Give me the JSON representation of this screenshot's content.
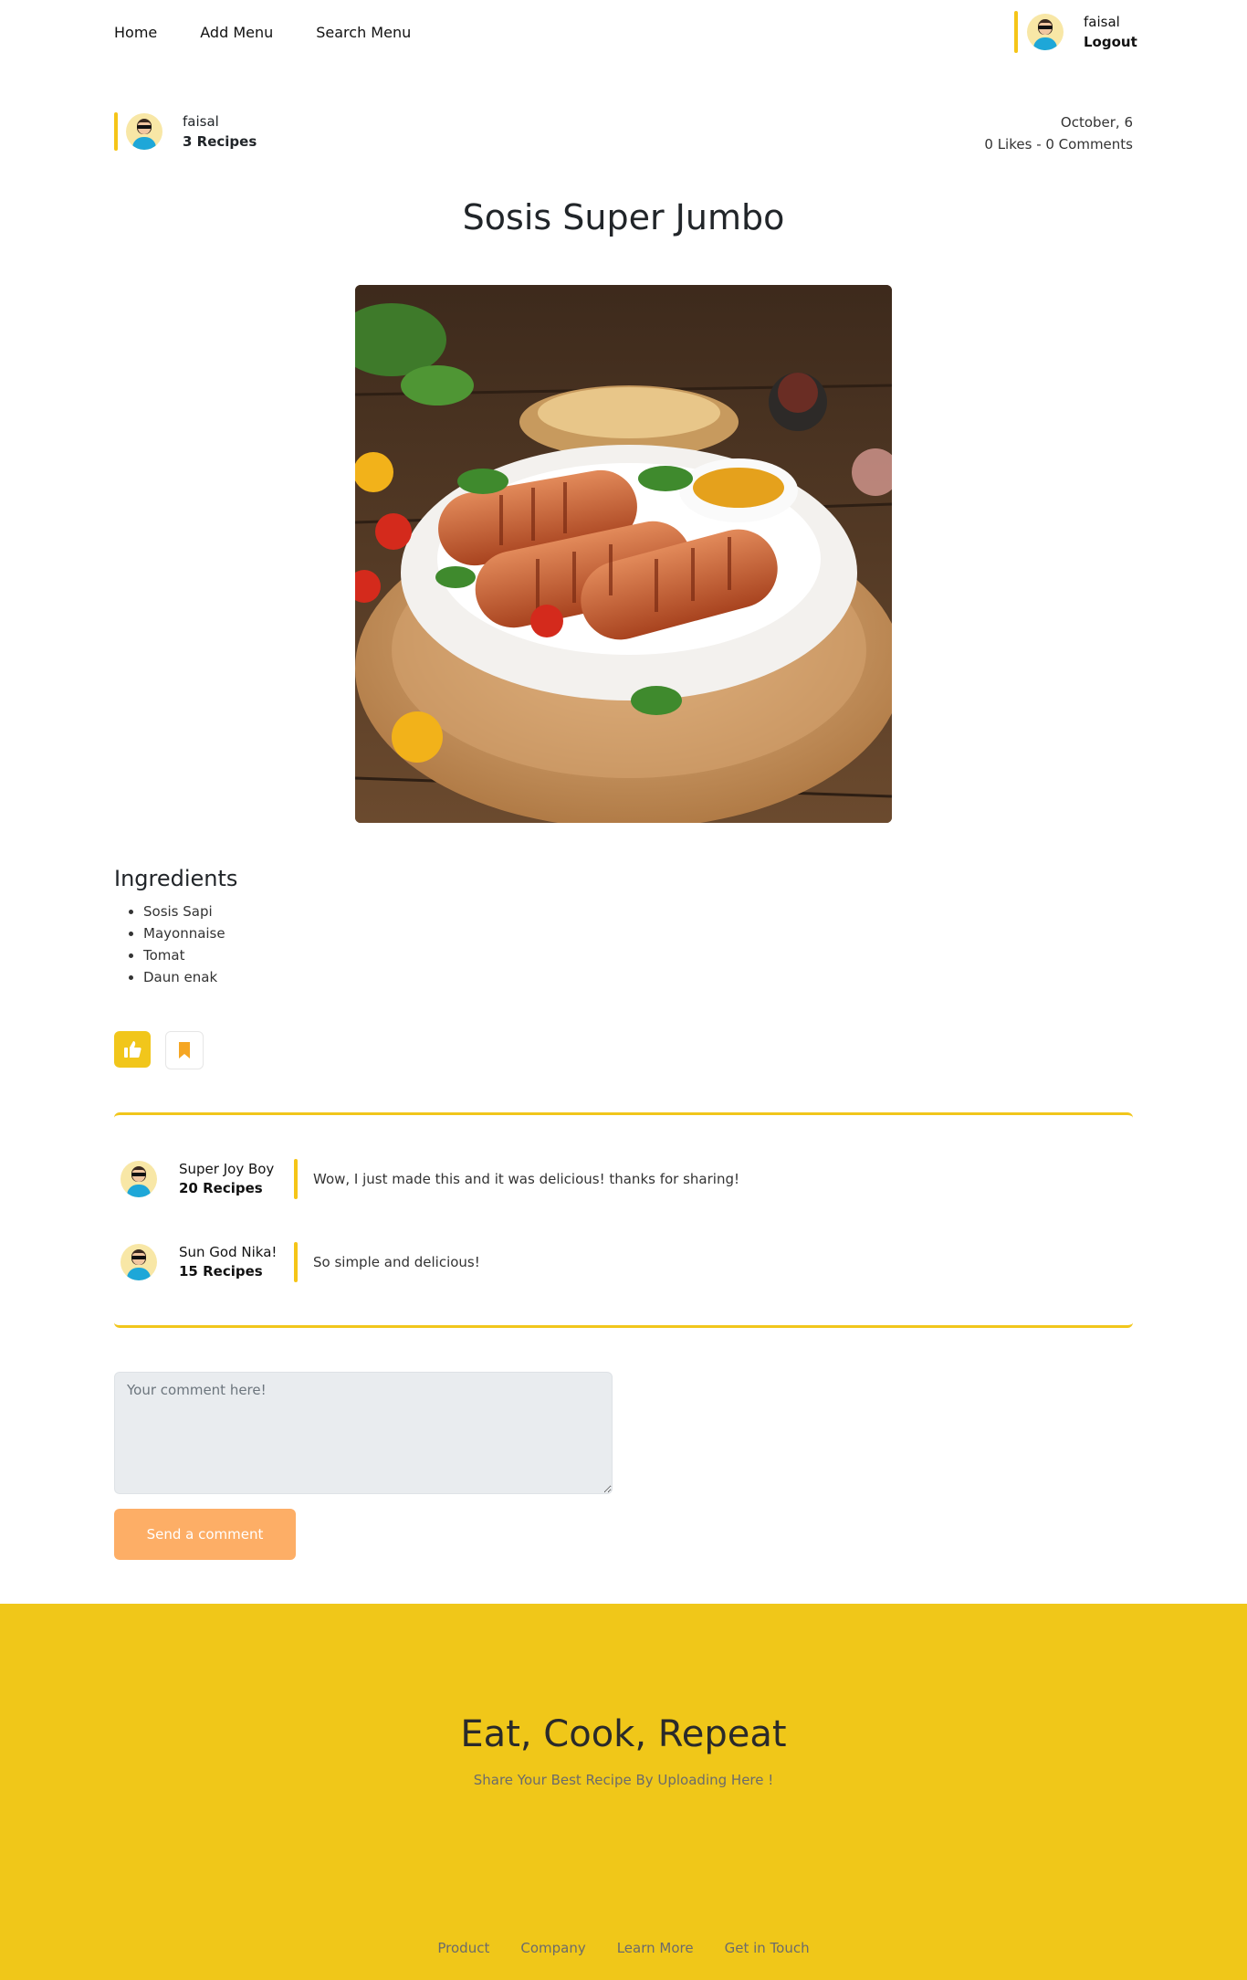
{
  "nav": {
    "links": [
      "Home",
      "Add Menu",
      "Search Menu"
    ],
    "user_name": "faisal",
    "logout_label": "Logout"
  },
  "author": {
    "name": "faisal",
    "recipes": "3 Recipes",
    "date": "October, 6",
    "stats": "0 Likes - 0 Comments"
  },
  "recipe": {
    "title": "Sosis Super Jumbo",
    "photo_icon": "sausage-photo"
  },
  "ingredients": {
    "heading": "Ingredients",
    "items": [
      "Sosis Sapi",
      "Mayonnaise",
      "Tomat",
      "Daun enak"
    ]
  },
  "actions": {
    "like_icon": "thumbs-up-icon",
    "save_icon": "bookmark-icon"
  },
  "comments": [
    {
      "user": "Super Joy Boy",
      "recipes": "20 Recipes",
      "text": "Wow, I just made this and it was delicious! thanks for sharing!"
    },
    {
      "user": "Sun God Nika!",
      "recipes": "15 Recipes",
      "text": "So simple and delicious!"
    }
  ],
  "comment_form": {
    "placeholder": "Your comment here!",
    "value": "",
    "send_label": "Send a comment"
  },
  "footer": {
    "title": "Eat, Cook, Repeat",
    "subtitle": "Share Your Best Recipe By Uploading Here !",
    "links": [
      "Product",
      "Company",
      "Learn More",
      "Get in Touch"
    ]
  },
  "colors": {
    "accent": "#f1c61b",
    "send_button": "#fdae66",
    "footer_bg": "#f0c719"
  }
}
